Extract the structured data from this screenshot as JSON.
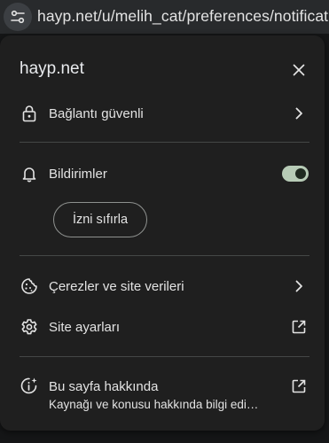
{
  "address_bar": {
    "url": "hayp.net/u/melih_cat/preferences/notificati",
    "site_info_icon": "tune-icon"
  },
  "popup": {
    "site_title": "hayp.net",
    "close_icon": "close-icon",
    "connection": {
      "label": "Bağlantı güvenli",
      "icon": "lock-icon",
      "trailing_icon": "chevron-right-icon"
    },
    "notifications": {
      "label": "Bildirimler",
      "icon": "bell-icon",
      "enabled": true,
      "reset_label": "İzni sıfırla"
    },
    "cookies": {
      "label": "Çerezler ve site verileri",
      "icon": "cookie-icon",
      "trailing_icon": "chevron-right-icon"
    },
    "site_settings": {
      "label": "Site ayarları",
      "icon": "gear-icon",
      "trailing_icon": "external-link-icon"
    },
    "about": {
      "label": "Bu sayfa hakkında",
      "sublabel": "Kaynağı ve konusu hakkında bilgi edi…",
      "icon": "info-sparkle-icon",
      "trailing_icon": "external-link-icon"
    }
  },
  "colors": {
    "popup_bg": "#1f1f1f",
    "toggle_on": "#b7cbb6",
    "divider": "#444746"
  }
}
